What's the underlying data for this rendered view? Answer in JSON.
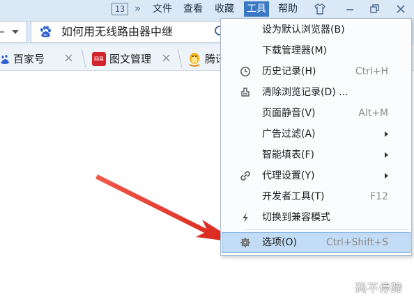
{
  "menubar": {
    "tab_count": "13",
    "chevron": "»",
    "items": [
      "文件",
      "查看",
      "收藏",
      "工具",
      "帮助"
    ]
  },
  "address": {
    "search_text": "如何用无线路由器中继"
  },
  "tabs": [
    {
      "label": "百家号",
      "close": "×"
    },
    {
      "label": "图文管理",
      "close": "×",
      "icon_text": "网易"
    },
    {
      "label": "腾讯",
      "close": ""
    }
  ],
  "tools_menu": {
    "items": [
      {
        "label": "设为默认浏览器(B)",
        "shortcut": "",
        "icon": "",
        "submenu": false
      },
      {
        "label": "下载管理器(M)",
        "shortcut": "",
        "icon": "",
        "submenu": false
      },
      {
        "label": "历史记录(H)",
        "shortcut": "Ctrl+H",
        "icon": "clock-icon",
        "submenu": false
      },
      {
        "label": "清除浏览记录(D) ...",
        "shortcut": "",
        "icon": "eraser-icon",
        "submenu": false
      },
      {
        "label": "页面静音(V)",
        "shortcut": "Alt+M",
        "icon": "",
        "submenu": false
      },
      {
        "label": "广告过滤(A)",
        "shortcut": "",
        "icon": "",
        "submenu": true
      },
      {
        "label": "智能填表(F)",
        "shortcut": "",
        "icon": "",
        "submenu": true
      },
      {
        "label": "代理设置(Y)",
        "shortcut": "",
        "icon": "link-icon",
        "submenu": true
      },
      {
        "label": "开发者工具(T)",
        "shortcut": "F12",
        "icon": "",
        "submenu": false
      },
      {
        "label": "切换到兼容模式",
        "shortcut": "",
        "icon": "lightning-icon",
        "submenu": false
      },
      {
        "label": "选项(O)",
        "shortcut": "Ctrl+Shift+S",
        "icon": "gear-icon",
        "submenu": false,
        "highlighted": true
      }
    ]
  },
  "watermark": "码不停蹄",
  "colors": {
    "menubar_bg": "#dbe8f6",
    "active_menu": "#3a78c4",
    "highlight_bg": "#c3dcf5",
    "arrow_red": "#e53935"
  }
}
